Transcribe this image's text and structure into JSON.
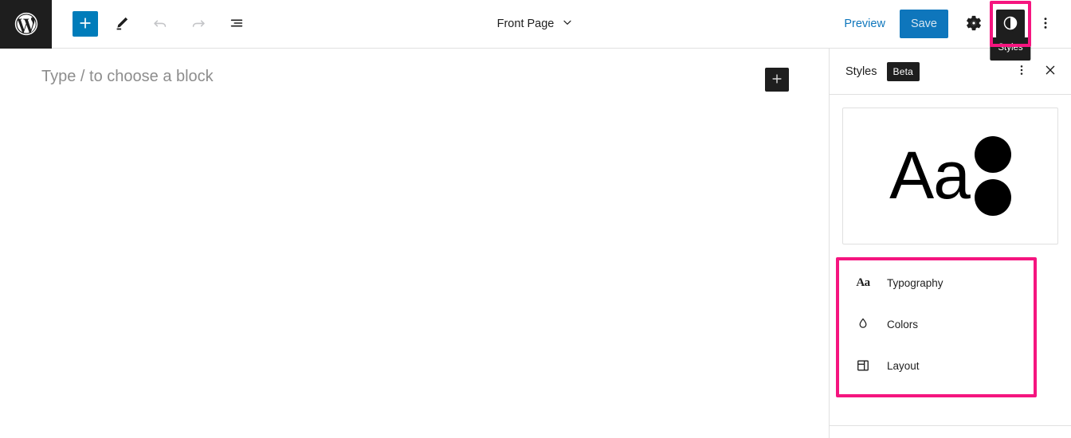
{
  "header": {
    "logo_icon": "wordpress-logo-icon",
    "left_tools": [
      {
        "name": "add-block-button",
        "icon": "plus-icon",
        "label": "Toggle block inserter",
        "state": "primary"
      },
      {
        "name": "edit-tool-button",
        "icon": "pencil-icon",
        "label": "Tools",
        "state": "normal"
      },
      {
        "name": "undo-button",
        "icon": "undo-arrow-icon",
        "label": "Undo",
        "state": "disabled"
      },
      {
        "name": "redo-button",
        "icon": "redo-arrow-icon",
        "label": "Redo",
        "state": "disabled"
      },
      {
        "name": "list-view-button",
        "icon": "list-view-icon",
        "label": "List View",
        "state": "normal"
      }
    ],
    "document_title": "Front Page",
    "document_title_chevron": "chevron-down-icon",
    "preview_label": "Preview",
    "save_label": "Save",
    "settings_icon": "gear-icon",
    "styles_icon": "contrast-half-circle-icon",
    "styles_tooltip": "Styles",
    "more_options_icon": "vertical-ellipsis-icon"
  },
  "canvas": {
    "placeholder": "Type / to choose a block",
    "adder_icon": "plus-icon"
  },
  "sidebar": {
    "title": "Styles",
    "badge": "Beta",
    "more_icon": "vertical-ellipsis-icon",
    "close_icon": "close-x-icon",
    "preview": {
      "sample_text": "Aa",
      "swatch_icon": "color-dots-icon"
    },
    "items": [
      {
        "label": "Typography",
        "icon": "typography-aa-icon"
      },
      {
        "label": "Colors",
        "icon": "color-droplet-icon"
      },
      {
        "label": "Layout",
        "icon": "layout-panel-icon"
      }
    ]
  },
  "colors": {
    "accent_blue": "#007cba",
    "link_blue": "#0e76bc",
    "highlight_pink": "#f5157f",
    "dark": "#1e1e1e",
    "border": "#e0e0e0",
    "placeholder_gray": "#8d8d8d"
  }
}
